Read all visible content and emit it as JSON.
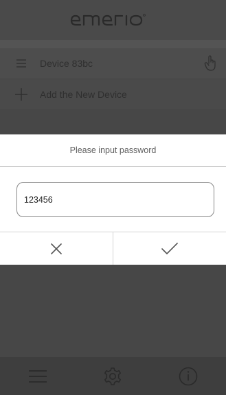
{
  "app": {
    "brand": "emerio"
  },
  "devices": {
    "items": [
      {
        "label": "Device 83bc"
      }
    ]
  },
  "add_device": {
    "label": "Add the New Device"
  },
  "password_dialog": {
    "title": "Please input password",
    "password_value": "123456",
    "cancel_icon": "close-icon",
    "confirm_icon": "checkmark-icon"
  },
  "tabbar": {
    "items": [
      {
        "icon": "list-icon"
      },
      {
        "icon": "gear-icon"
      },
      {
        "icon": "info-icon"
      }
    ]
  },
  "colors": {
    "overlay_background": "#484848",
    "dialog_background": "#ffffff",
    "divider": "#d4d4d4",
    "tabbar_background": "#3e3e3e"
  }
}
